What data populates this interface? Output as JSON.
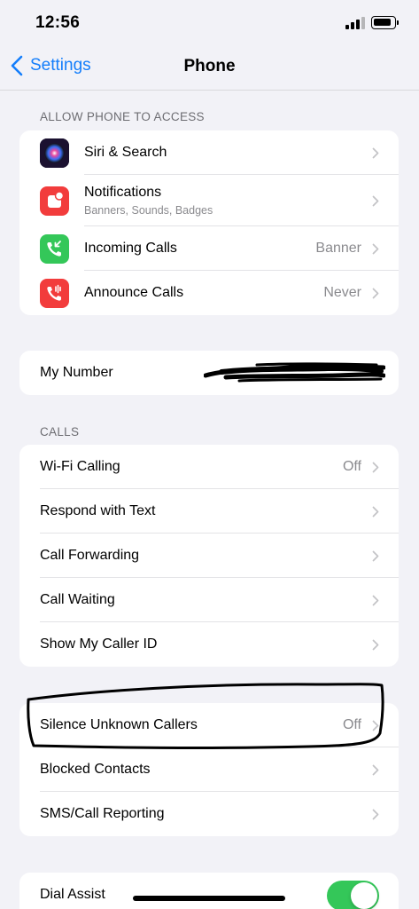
{
  "status_bar": {
    "time": "12:56"
  },
  "nav": {
    "back_label": "Settings",
    "title": "Phone"
  },
  "allow_access": {
    "header": "ALLOW PHONE TO ACCESS",
    "items": [
      {
        "label": "Siri & Search",
        "icon": "siri-icon"
      },
      {
        "label": "Notifications",
        "subtitle": "Banners, Sounds, Badges",
        "icon": "notifications-icon"
      },
      {
        "label": "Incoming Calls",
        "value": "Banner",
        "icon": "incoming-calls-icon"
      },
      {
        "label": "Announce Calls",
        "value": "Never",
        "icon": "announce-calls-icon"
      }
    ]
  },
  "my_number": {
    "label": "My Number"
  },
  "calls": {
    "header": "CALLS",
    "items": [
      {
        "label": "Wi-Fi Calling",
        "value": "Off"
      },
      {
        "label": "Respond with Text"
      },
      {
        "label": "Call Forwarding"
      },
      {
        "label": "Call Waiting"
      },
      {
        "label": "Show My Caller ID"
      }
    ]
  },
  "blocking": {
    "items": [
      {
        "label": "Silence Unknown Callers",
        "value": "Off"
      },
      {
        "label": "Blocked Contacts"
      },
      {
        "label": "SMS/Call Reporting"
      }
    ]
  },
  "dial_assist": {
    "label": "Dial Assist",
    "enabled": true
  },
  "colors": {
    "accent": "#147efb",
    "background": "#f2f2f7",
    "toggle_on": "#34c759",
    "notifications": "#f23c3c",
    "incoming": "#34c759",
    "announce": "#f23c3c"
  }
}
